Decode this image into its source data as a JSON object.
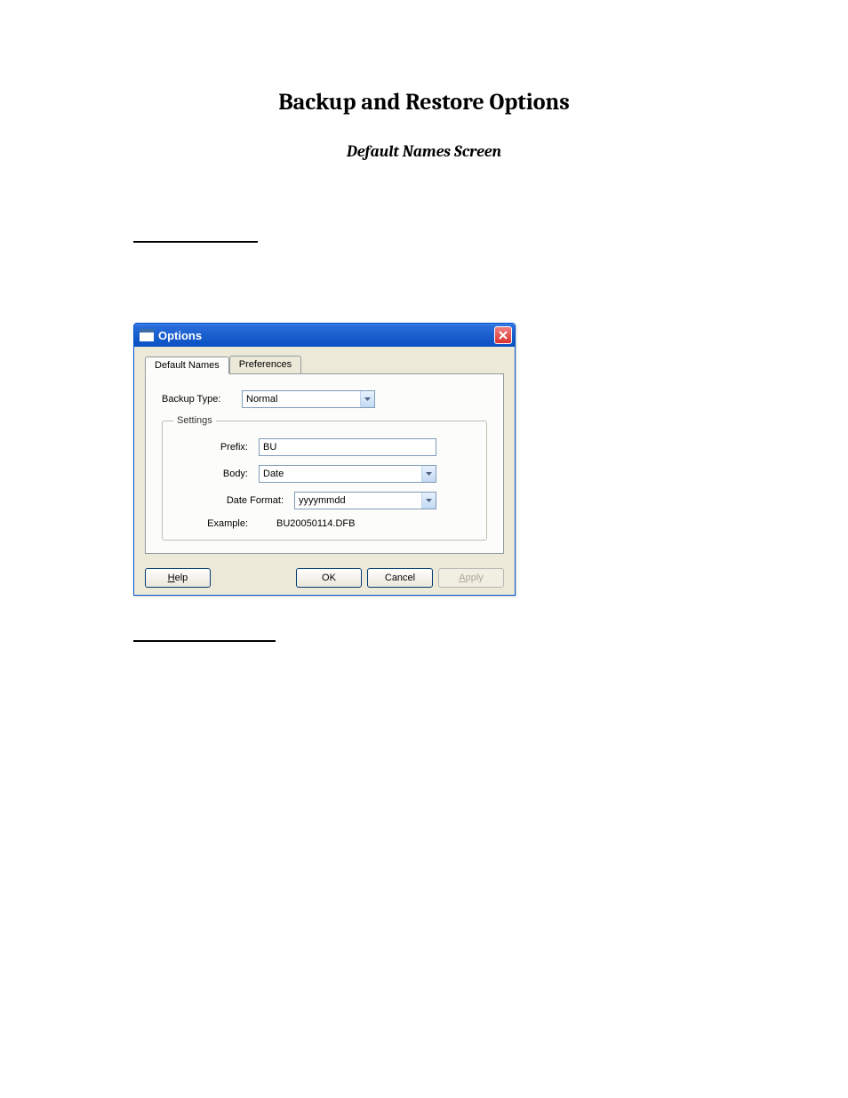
{
  "page": {
    "title": "Backup and Restore Options",
    "subtitle": "Default Names Screen"
  },
  "dialog": {
    "title": "Options",
    "tabs": [
      {
        "label": "Default Names"
      },
      {
        "label": "Preferences"
      }
    ],
    "backupType": {
      "label": "Backup Type:",
      "value": "Normal"
    },
    "settings": {
      "legend": "Settings",
      "prefix": {
        "label": "Prefix:",
        "value": "BU"
      },
      "body": {
        "label": "Body:",
        "value": "Date"
      },
      "dateFormat": {
        "label": "Date Format:",
        "value": "yyyymmdd"
      },
      "example": {
        "label": "Example:",
        "value": "BU20050114.DFB"
      }
    },
    "buttons": {
      "help": "Help",
      "helpHotkey": "H",
      "ok": "OK",
      "cancel": "Cancel",
      "apply": "Apply",
      "applyHotkey": "A"
    }
  }
}
